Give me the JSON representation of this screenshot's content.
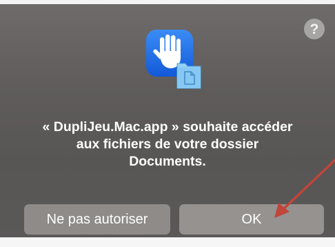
{
  "dialog": {
    "help_label": "?",
    "message_line1": "« DupliJeu.Mac.app » souhaite accéder",
    "message_line2": "aux fichiers de votre dossier",
    "message_line3": "Documents.",
    "deny_button_label": "Ne pas autoriser",
    "ok_button_label": "OK",
    "icon": "privacy-hand-folder-icon",
    "annotation": "red-arrow-pointing-to-ok"
  },
  "colors": {
    "background": "#5f5c5b",
    "button": "#8e8b89",
    "icon_blue": "#1e6ef0",
    "folder_blue": "#7fc6f2",
    "arrow_red": "#c0453a"
  }
}
